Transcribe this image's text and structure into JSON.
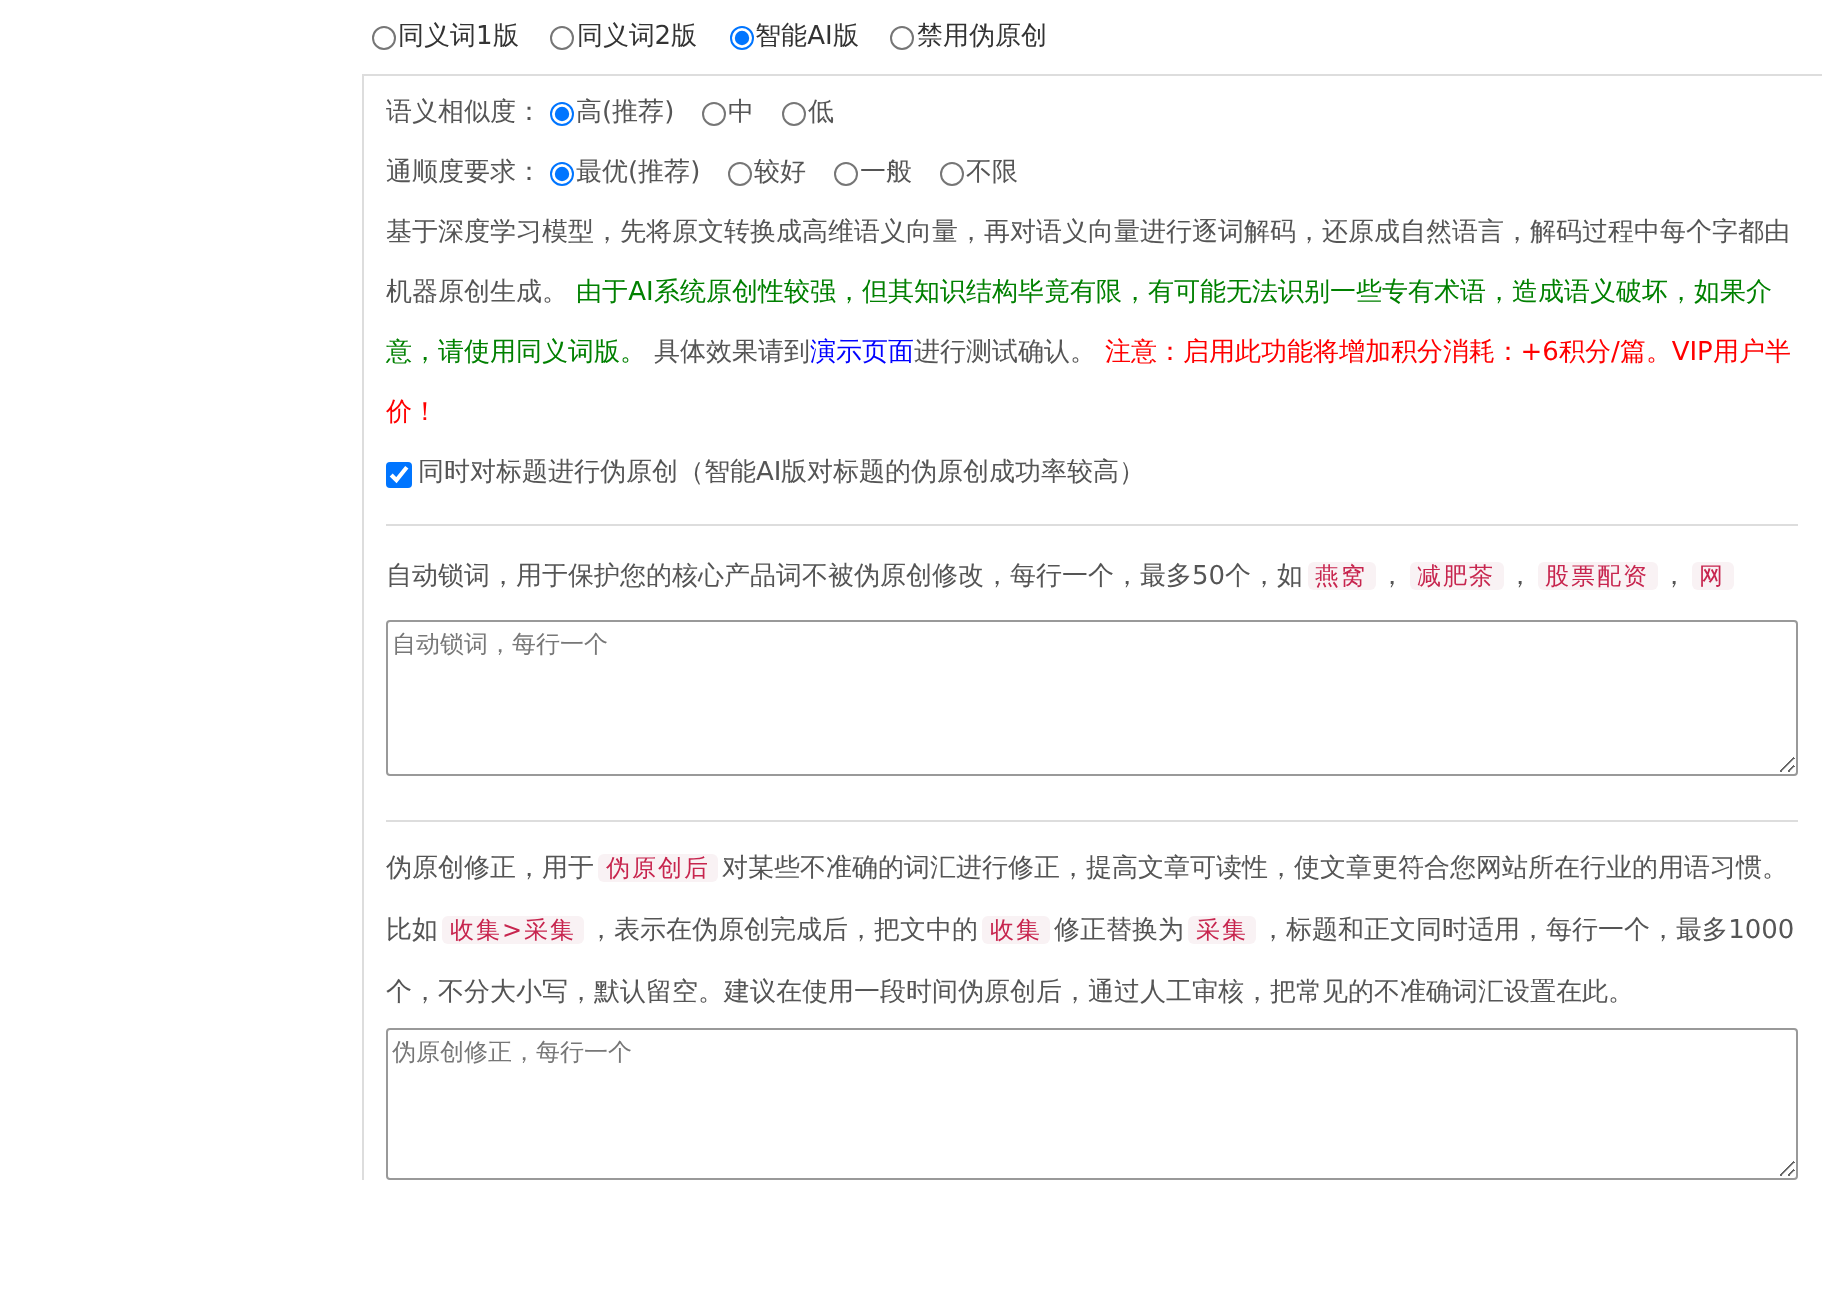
{
  "mode_options": [
    {
      "label": "同义词1版",
      "selected": false
    },
    {
      "label": "同义词2版",
      "selected": false
    },
    {
      "label": "智能AI版",
      "selected": true
    },
    {
      "label": "禁用伪原创",
      "selected": false
    }
  ],
  "settings": [
    {
      "label": "语义相似度：",
      "options": [
        {
          "label": "高(推荐)",
          "selected": true
        },
        {
          "label": "中",
          "selected": false
        },
        {
          "label": "低",
          "selected": false
        }
      ]
    },
    {
      "label": "通顺度要求：",
      "options": [
        {
          "label": "最优(推荐)",
          "selected": true
        },
        {
          "label": "较好",
          "selected": false
        },
        {
          "label": "一般",
          "selected": false
        },
        {
          "label": "不限",
          "selected": false
        }
      ]
    }
  ],
  "ai_description": [
    {
      "kind": "plain",
      "text": "基于深度学习模型，先将原文转换成高维语义向量，再对语义向量进行逐词解码，还原成自然语言，解码过程中每个字都由机器原创生成。 "
    },
    {
      "kind": "green",
      "text": "由于AI系统原创性较强，但其知识结构毕竟有限，有可能无法识别一些专有术语，造成语义破坏，如果介意，请使用同义词版。"
    },
    {
      "kind": "plain",
      "text": " 具体效果请到"
    },
    {
      "kind": "link",
      "text": "演示页面"
    },
    {
      "kind": "plain",
      "text": "进行测试确认。 "
    },
    {
      "kind": "red",
      "text": "注意：启用此功能将增加积分消耗：+6积分/篇。VIP用户半价！"
    }
  ],
  "title_rewrite": {
    "label": "同时对标题进行伪原创（智能AI版对标题的伪原创成功率较高）",
    "checked": true
  },
  "auto_lock": {
    "description": [
      {
        "kind": "plain",
        "text": "自动锁词，用于保护您的核心产品词不被伪原创修改，每行一个，最多50个，如"
      },
      {
        "kind": "tag",
        "text": "燕窝"
      },
      {
        "kind": "plain",
        "text": "，"
      },
      {
        "kind": "tag",
        "text": "减肥茶"
      },
      {
        "kind": "plain",
        "text": "，"
      },
      {
        "kind": "tag",
        "text": "股票配资"
      },
      {
        "kind": "plain",
        "text": "，"
      },
      {
        "kind": "tag",
        "text": "网"
      }
    ],
    "placeholder": "自动锁词，每行一个"
  },
  "correction": {
    "description": [
      {
        "kind": "plain",
        "text": "伪原创修正，用于"
      },
      {
        "kind": "tag",
        "text": "伪原创后"
      },
      {
        "kind": "plain",
        "text": "对某些不准确的词汇进行修正，提高文章可读性，使文章更符合您网站所在行业的用语习惯。比如"
      },
      {
        "kind": "tag",
        "text": "收集>采集"
      },
      {
        "kind": "plain",
        "text": "，表示在伪原创完成后，把文中的"
      },
      {
        "kind": "tag",
        "text": "收集"
      },
      {
        "kind": "plain",
        "text": "修正替换为"
      },
      {
        "kind": "tag",
        "text": "采集"
      },
      {
        "kind": "plain",
        "text": "，标题和正文同时适用，每行一个，最多1000个，不分大小写，默认留空。建议在使用一段时间伪原创后，通过人工审核，把常见的不准确词汇设置在此。"
      }
    ],
    "placeholder": "伪原创修正，每行一个"
  }
}
